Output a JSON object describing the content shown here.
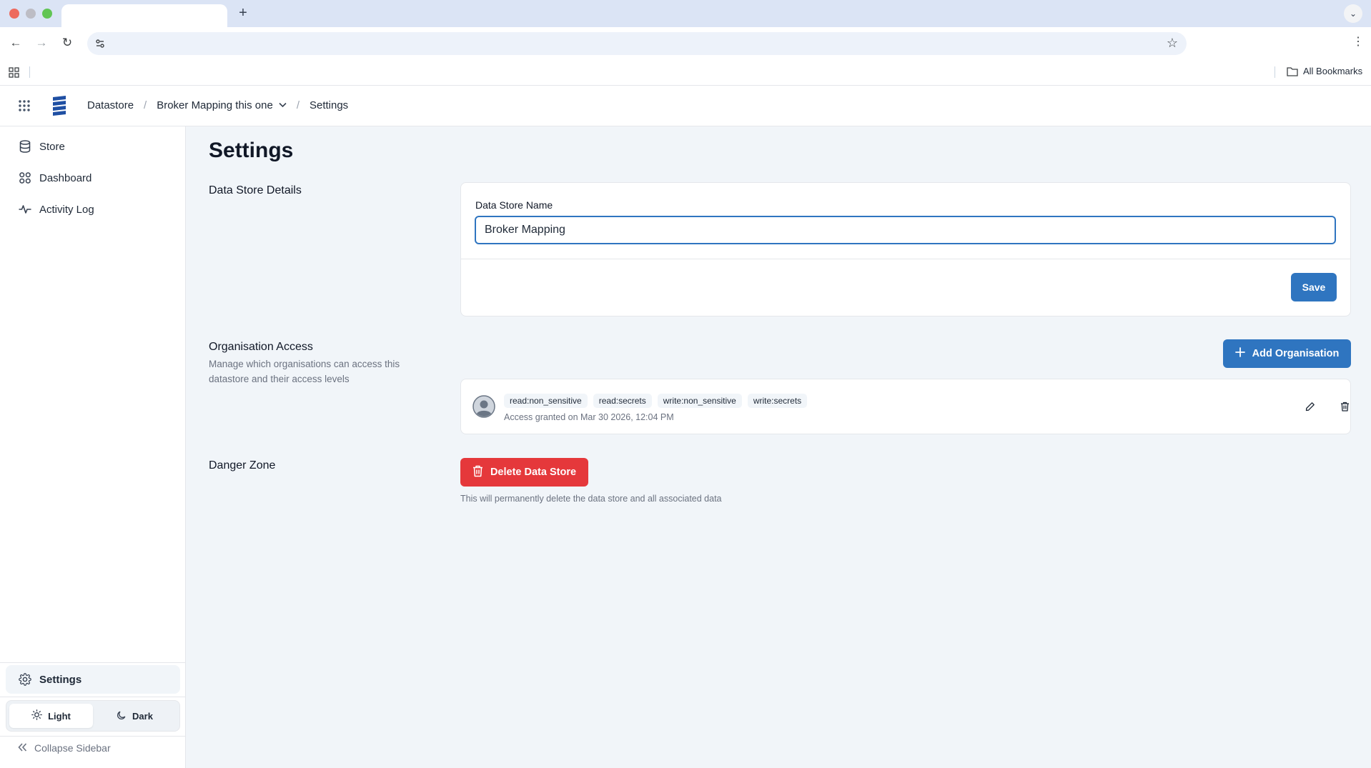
{
  "browser": {
    "bookmarks_label": "All Bookmarks"
  },
  "header": {
    "breadcrumbs": [
      "Datastore",
      "Broker Mapping this one",
      "Settings"
    ]
  },
  "sidebar": {
    "items": [
      {
        "label": "Store",
        "icon": "database-icon"
      },
      {
        "label": "Dashboard",
        "icon": "dashboard-grid-icon"
      },
      {
        "label": "Activity Log",
        "icon": "activity-pulse-icon"
      }
    ],
    "settings_label": "Settings",
    "theme": {
      "light_label": "Light",
      "dark_label": "Dark",
      "selected": "Light"
    },
    "collapse_label": "Collapse Sidebar"
  },
  "page": {
    "title": "Settings",
    "details": {
      "section_title": "Data Store Details",
      "field_label": "Data Store Name",
      "field_value": "Broker Mapping",
      "save_label": "Save"
    },
    "org_access": {
      "section_title": "Organisation Access",
      "description": "Manage which organisations can access this datastore and their access levels",
      "add_label": "Add Organisation",
      "entries": [
        {
          "permissions": [
            "read:non_sensitive",
            "read:secrets",
            "write:non_sensitive",
            "write:secrets"
          ],
          "access_text": "Access granted on Mar 30 2026, 12:04 PM"
        }
      ]
    },
    "danger": {
      "section_title": "Danger Zone",
      "delete_label": "Delete Data Store",
      "note": "This will permanently delete the data store and all associated data"
    }
  },
  "colors": {
    "primary": "#2f75c0",
    "danger": "#e5383b",
    "annotation_arrow": "#e8281e"
  }
}
